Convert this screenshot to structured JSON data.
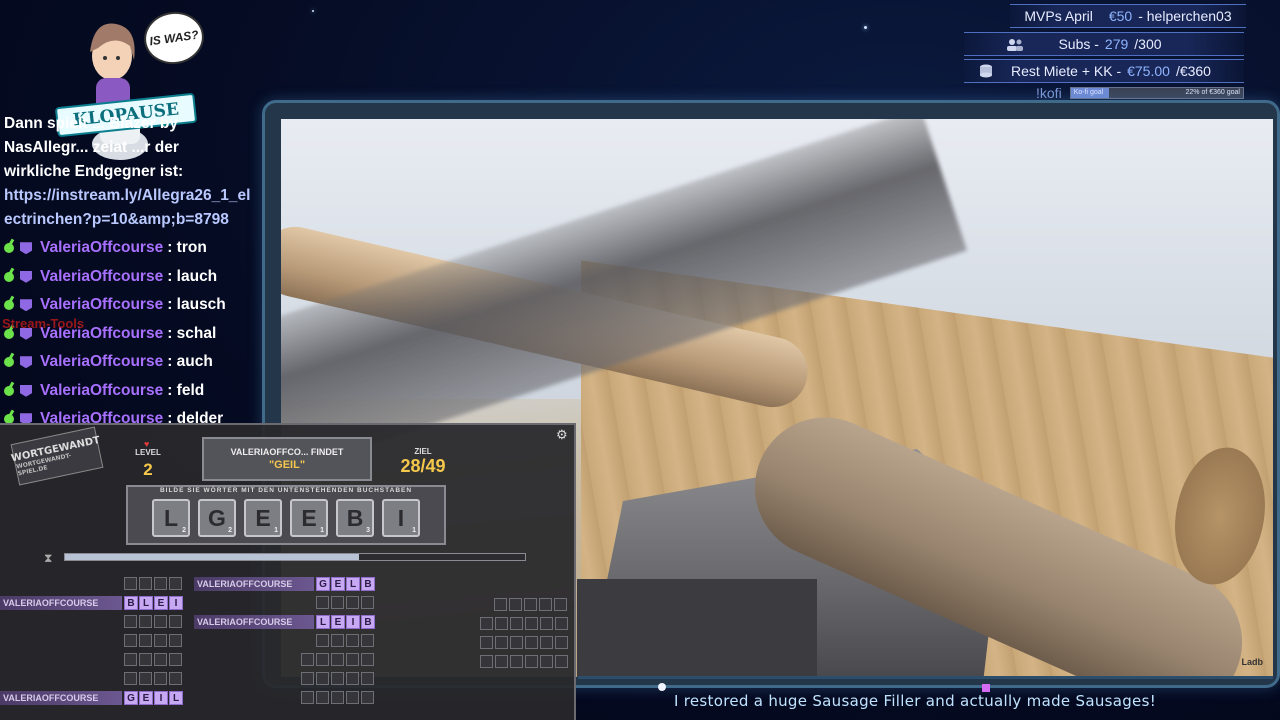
{
  "stats": {
    "mvps_label": "MVPs April",
    "mvps_amount": "€50",
    "mvps_user": "- helperchen03",
    "subs_label": "Subs -",
    "subs_current": "279",
    "subs_goal": "/300",
    "rent_label": "Rest Miete + KK -",
    "rent_current": "€75.00",
    "rent_goal": "/€360",
    "kofi_label": "!kofi",
    "kofi_bar_left": "Ko-fi goal",
    "kofi_bar_right": "22% of €360 goal",
    "kofi_progress": 0.22
  },
  "overlay": {
    "speech": "IS WAS?",
    "band": "KLOPAUSE",
    "red_text": "Stream-Tools"
  },
  "chat": {
    "intro_line1": "Dann spielt ... Blazer by",
    "intro_line2": "NasAllegr... zeiat ...r der",
    "intro_line3": "wirkliche Endgegner ist:",
    "link_line1": "https://instream.ly/Allegra26_1_el",
    "link_line2": "ectrinchen?p=10&amp;b=8798",
    "messages": [
      {
        "user": "ValeriaOffcourse",
        "text": ": tron"
      },
      {
        "user": "ValeriaOffcourse",
        "text": ": lauch"
      },
      {
        "user": "ValeriaOffcourse",
        "text": ": lausch"
      },
      {
        "user": "ValeriaOffcourse",
        "text": ": schal"
      },
      {
        "user": "ValeriaOffcourse",
        "text": ": auch"
      },
      {
        "user": "ValeriaOffcourse",
        "text": ": feld"
      },
      {
        "user": "ValeriaOffcourse",
        "text": ": delder"
      }
    ]
  },
  "game": {
    "logo": "WORTGEWANDT",
    "logo_url": "WORTGEWANDT-SPIEL.DE",
    "level_label": "LEVEL",
    "level_value": "2",
    "find_line1": "VALERIAOFFCO... FINDET",
    "find_line2": "\"GEIL\"",
    "ziel_label": "ZIEL",
    "ziel_value": "28/49",
    "tiles_caption": "BILDE SIE WÖRTER MIT DEN UNTENSTEHENDEN BUCHSTABEN",
    "tiles": [
      {
        "letter": "L",
        "score": "2"
      },
      {
        "letter": "G",
        "score": "2"
      },
      {
        "letter": "E",
        "score": "1"
      },
      {
        "letter": "E",
        "score": "1"
      },
      {
        "letter": "B",
        "score": "3"
      },
      {
        "letter": "I",
        "score": "1"
      }
    ],
    "timer_fraction": 0.64,
    "found": [
      {
        "user": "VALERIAOFFCOURSE",
        "letters": [
          "G",
          "E",
          "L",
          "B"
        ]
      },
      {
        "user": "VALERIAOFFCOURSE",
        "letters": [
          "B",
          "L",
          "E",
          "I"
        ]
      },
      {
        "user": "VALERIAOFFCOURSE",
        "letters": [
          "L",
          "E",
          "I",
          "B"
        ]
      },
      {
        "user": "VALERIAOFFCOURSE",
        "letters": [
          "G",
          "E",
          "I",
          "L"
        ]
      }
    ]
  },
  "video": {
    "watermark": "Ladb",
    "title": "I restored a huge Sausage Filler and actually made Sausages!"
  }
}
